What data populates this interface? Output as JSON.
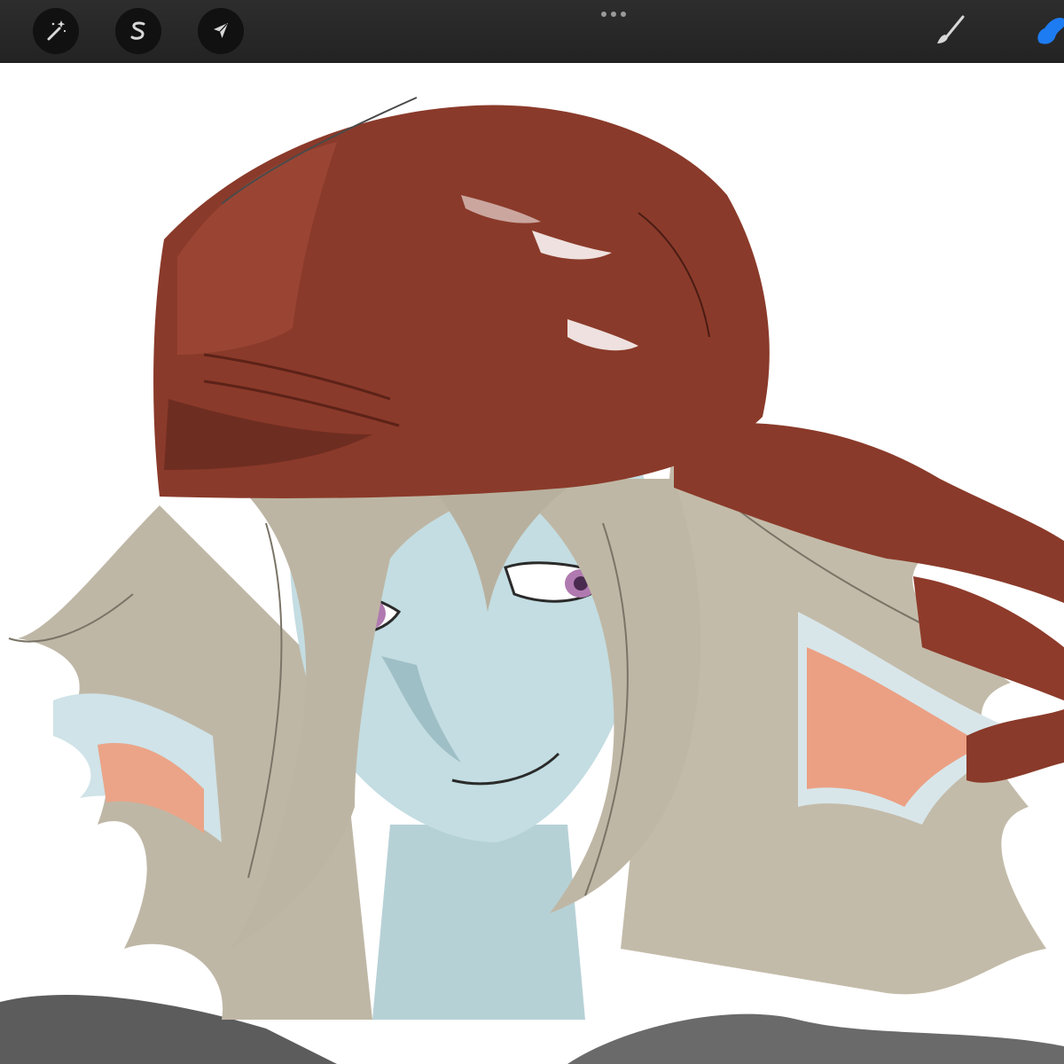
{
  "toolbar": {
    "left_tools": [
      {
        "name": "adjustments",
        "icon": "magic-wand-icon"
      },
      {
        "name": "selection",
        "icon": "selection-s-icon"
      },
      {
        "name": "transform",
        "icon": "arrow-cursor-icon"
      }
    ],
    "more_menu": {
      "icon": "more-dots-icon"
    },
    "right_tools": [
      {
        "name": "brush",
        "icon": "brush-icon",
        "active": false
      },
      {
        "name": "smudge",
        "icon": "smudge-icon",
        "active": true
      }
    ]
  },
  "colors": {
    "toolbar_bg": "#2a2a2a",
    "icon_button_bg": "#111111",
    "icon_color": "#d8d8d8",
    "active_tool_color": "#1e7cf2",
    "canvas_bg": "#ffffff",
    "cap_red": "#8a3a2a",
    "skin_blue": "#bfdbe0",
    "hair_beige": "#bdb5a3",
    "fin_orange": "#e99f80",
    "eye_purple": "#b07ab0"
  },
  "canvas": {
    "content": "artwork-illustration"
  }
}
